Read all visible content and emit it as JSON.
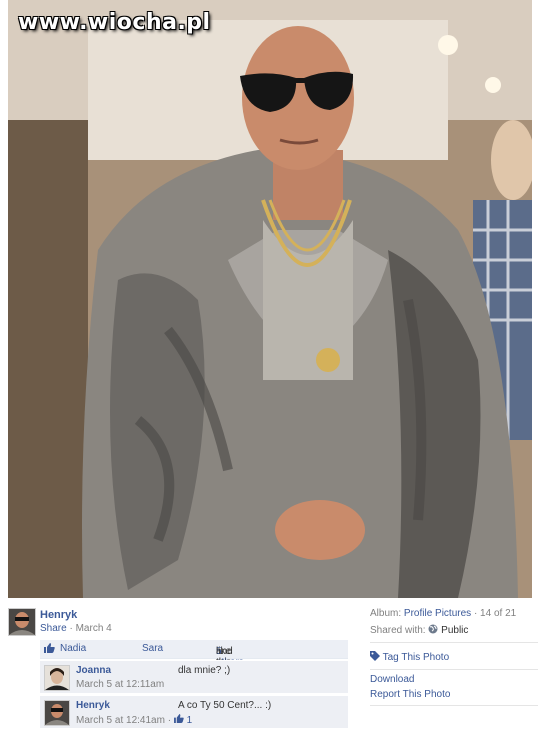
{
  "watermark": "www.wiocha.pl",
  "photo": {
    "subject": "portrait-photo",
    "colors": {
      "background": "#a48e76",
      "coat": "#8a8680",
      "coat_dark": "#4a4744",
      "skin": "#c98b6b",
      "sunglasses": "#151515",
      "chain": "#d4b15a"
    }
  },
  "owner": {
    "name": "Henryk",
    "share_label": "Share",
    "separator": "·",
    "date": "March 4"
  },
  "likes": {
    "icon": "thumbs-up-icon",
    "names": [
      "Nadia",
      "Sara"
    ],
    "and_text": "and",
    "others_text": "5 others",
    "suffix": "like this."
  },
  "comments": [
    {
      "author": "Joanna",
      "text": "dla mnie? ;)",
      "time": "March 5 at 12:11am"
    },
    {
      "author": "Henryk",
      "text": "A co Ty 50 Cent?... :)",
      "time": "March 5 at 12:41am",
      "separator": "·",
      "like_icon": "thumbs-up-icon",
      "like_count": "1"
    }
  ],
  "sidebar": {
    "album_label": "Album:",
    "album_name": "Profile Pictures",
    "position": "· 14 of 21",
    "shared_label": "Shared with:",
    "privacy_icon": "globe-icon",
    "privacy": "Public",
    "tag_icon": "tag-icon",
    "tag_label": "Tag This Photo",
    "download_label": "Download",
    "report_label": "Report This Photo"
  },
  "theme": {
    "link": "#3b5998",
    "muted": "#808080",
    "panel": "#edeff4"
  }
}
